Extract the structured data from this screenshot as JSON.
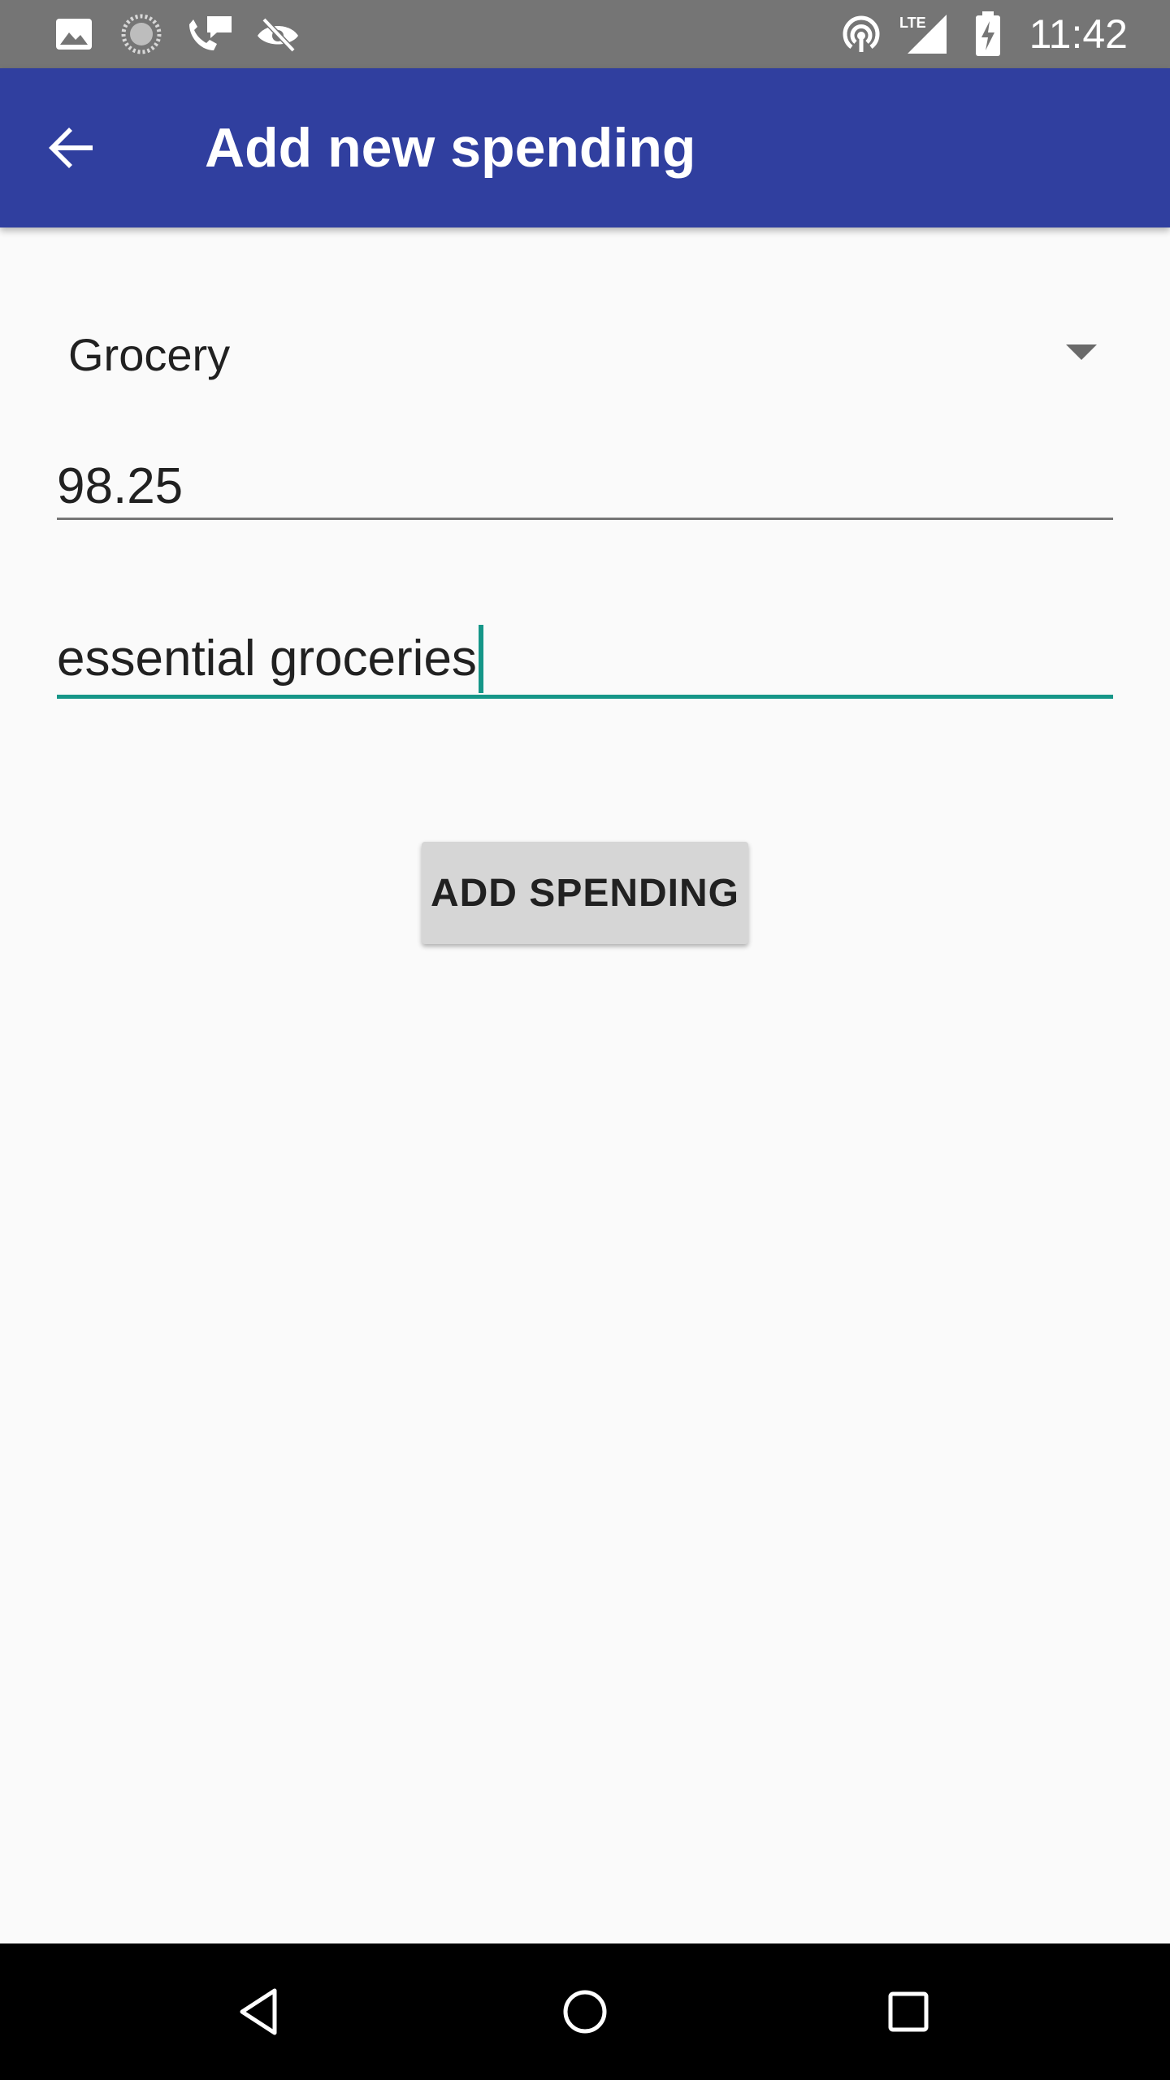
{
  "status_bar": {
    "time": "11:42",
    "network_label": "LTE",
    "left_icons": [
      "image-icon",
      "loading-icon",
      "call-chat-icon",
      "eye-off-icon"
    ],
    "right_icons": [
      "hotspot-icon",
      "signal-icon",
      "battery-charging-icon"
    ]
  },
  "app_bar": {
    "title": "Add new spending",
    "back_icon": "arrow-back-icon",
    "background_color": "#303f9f"
  },
  "form": {
    "category": {
      "selected": "Grocery"
    },
    "amount": {
      "value": "98.25"
    },
    "note": {
      "value": "essential groceries"
    },
    "submit_label": "ADD SPENDING",
    "accent_color": "#159688"
  },
  "nav_bar": {
    "buttons": [
      "back-triangle-icon",
      "home-circle-icon",
      "recents-square-icon"
    ]
  }
}
